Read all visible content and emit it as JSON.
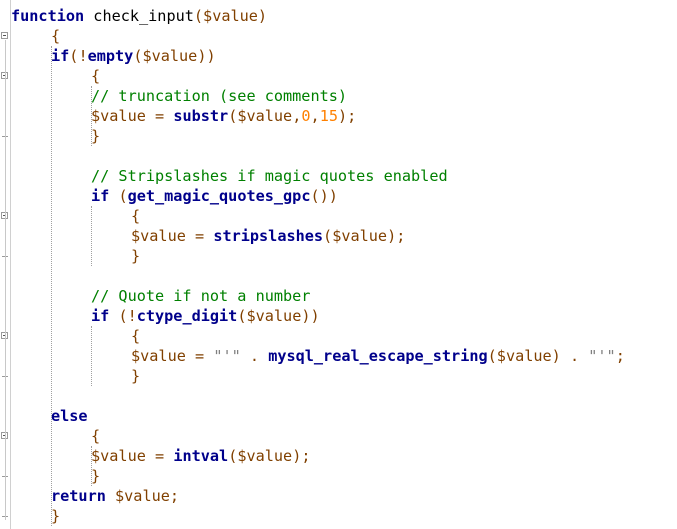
{
  "editor": {
    "lines": [
      [
        [
          "kw",
          "function"
        ],
        [
          "pl",
          " check_input"
        ],
        [
          "op",
          "("
        ],
        [
          "var",
          "$value"
        ],
        [
          "op",
          ")"
        ]
      ],
      [
        [
          "op",
          "{"
        ]
      ],
      [
        [
          "kw",
          "if"
        ],
        [
          "op",
          "(!"
        ],
        [
          "kw",
          "empty"
        ],
        [
          "op",
          "("
        ],
        [
          "var",
          "$value"
        ],
        [
          "op",
          "))"
        ]
      ],
      [
        [
          "op",
          "{"
        ]
      ],
      [
        [
          "cm",
          "// truncation (see comments)"
        ]
      ],
      [
        [
          "var",
          "$value"
        ],
        [
          "op",
          " = "
        ],
        [
          "kw",
          "substr"
        ],
        [
          "op",
          "("
        ],
        [
          "var",
          "$value"
        ],
        [
          "op",
          ","
        ],
        [
          "num",
          "0"
        ],
        [
          "op",
          ","
        ],
        [
          "num",
          "15"
        ],
        [
          "op",
          ");"
        ]
      ],
      [
        [
          "op",
          "}"
        ]
      ],
      [],
      [
        [
          "cm",
          "// Stripslashes if magic quotes enabled"
        ]
      ],
      [
        [
          "kw",
          "if"
        ],
        [
          "op",
          " ("
        ],
        [
          "kw",
          "get_magic_quotes_gpc"
        ],
        [
          "op",
          "())"
        ]
      ],
      [
        [
          "op",
          "{"
        ]
      ],
      [
        [
          "var",
          "$value"
        ],
        [
          "op",
          " = "
        ],
        [
          "kw",
          "stripslashes"
        ],
        [
          "op",
          "("
        ],
        [
          "var",
          "$value"
        ],
        [
          "op",
          ");"
        ]
      ],
      [
        [
          "op",
          "}"
        ]
      ],
      [],
      [
        [
          "cm",
          "// Quote if not a number"
        ]
      ],
      [
        [
          "kw",
          "if"
        ],
        [
          "op",
          " (!"
        ],
        [
          "kw",
          "ctype_digit"
        ],
        [
          "op",
          "("
        ],
        [
          "var",
          "$value"
        ],
        [
          "op",
          "))"
        ]
      ],
      [
        [
          "op",
          "{"
        ]
      ],
      [
        [
          "var",
          "$value"
        ],
        [
          "op",
          " = "
        ],
        [
          "str",
          "\"'\""
        ],
        [
          "op",
          " . "
        ],
        [
          "kw",
          "mysql_real_escape_string"
        ],
        [
          "op",
          "("
        ],
        [
          "var",
          "$value"
        ],
        [
          "op",
          ")"
        ],
        [
          "op",
          " . "
        ],
        [
          "str",
          "\"'\""
        ],
        [
          "op",
          ";"
        ]
      ],
      [
        [
          "op",
          "}"
        ]
      ],
      [],
      [
        [
          "kw",
          "else"
        ]
      ],
      [
        [
          "op",
          "{"
        ]
      ],
      [
        [
          "var",
          "$value"
        ],
        [
          "op",
          " = "
        ],
        [
          "kw",
          "intval"
        ],
        [
          "op",
          "("
        ],
        [
          "var",
          "$value"
        ],
        [
          "op",
          ");"
        ]
      ],
      [
        [
          "op",
          "}"
        ]
      ],
      [
        [
          "kw",
          "return"
        ],
        [
          "var",
          " $value"
        ],
        [
          "op",
          ";"
        ]
      ],
      [
        [
          "op",
          "}"
        ]
      ]
    ],
    "indents": [
      0,
      1,
      1,
      2,
      2,
      2,
      2,
      0,
      2,
      2,
      3,
      3,
      3,
      0,
      2,
      2,
      3,
      3,
      3,
      0,
      1,
      2,
      2,
      2,
      1,
      1
    ],
    "colors": {
      "keyword": "#00008b",
      "operator": "#804000",
      "variable": "#804000",
      "number": "#ff8000",
      "comment": "#008000",
      "string": "#808080",
      "plain": "#000000"
    }
  }
}
